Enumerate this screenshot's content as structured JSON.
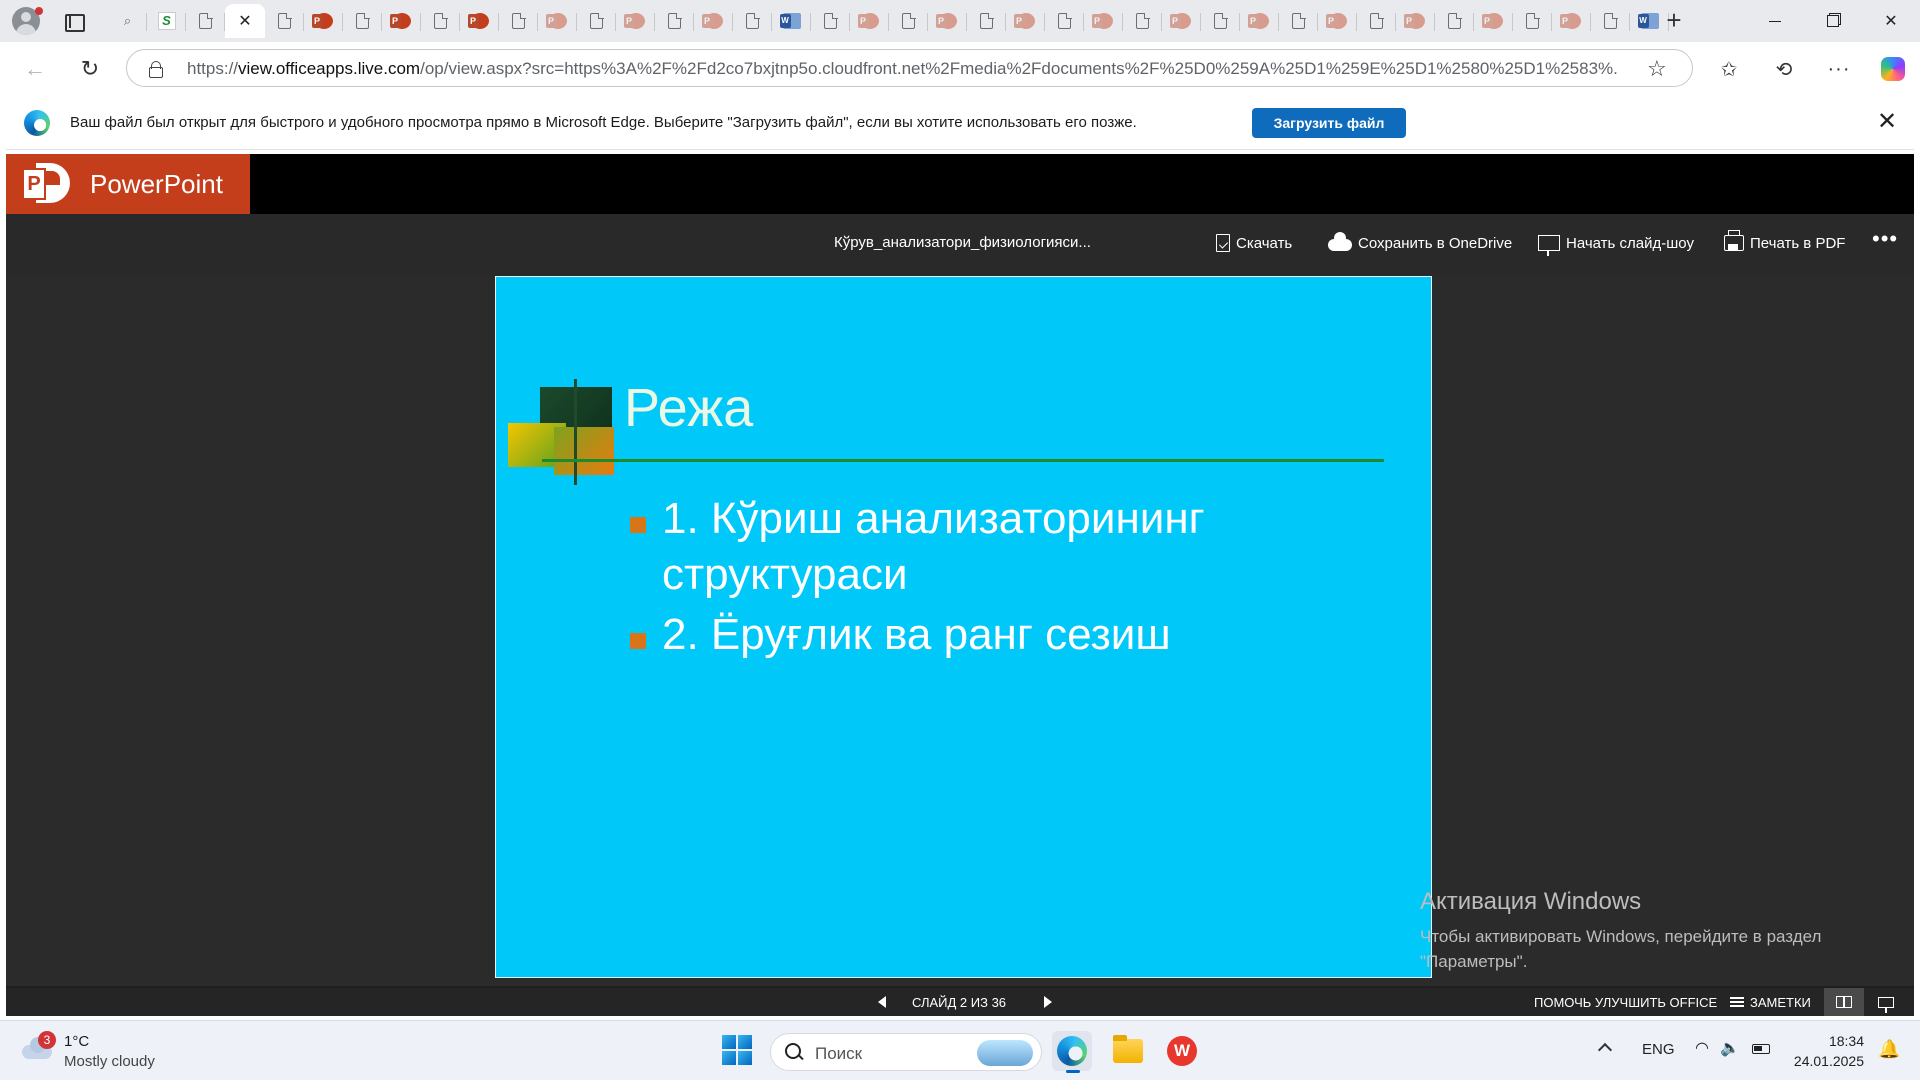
{
  "browser": {
    "tabs": [
      {
        "icon": "search-icon",
        "active": false
      },
      {
        "icon": "green-s-icon",
        "active": false
      },
      {
        "icon": "doc-icon",
        "active": false
      },
      {
        "icon": "close-icon",
        "active": true
      },
      {
        "icon": "doc-icon",
        "active": false
      },
      {
        "icon": "powerpoint-icon",
        "active": false
      },
      {
        "icon": "doc-icon",
        "active": false
      },
      {
        "icon": "powerpoint-icon",
        "active": false
      },
      {
        "icon": "doc-icon",
        "active": false
      },
      {
        "icon": "powerpoint-icon",
        "active": false
      },
      {
        "icon": "doc-icon",
        "active": false
      },
      {
        "icon": "powerpoint-faded-icon",
        "active": false
      },
      {
        "icon": "doc-icon",
        "active": false
      },
      {
        "icon": "powerpoint-faded-icon",
        "active": false
      },
      {
        "icon": "doc-icon",
        "active": false
      },
      {
        "icon": "powerpoint-faded-icon",
        "active": false
      },
      {
        "icon": "doc-icon",
        "active": false
      },
      {
        "icon": "word-icon",
        "active": false
      },
      {
        "icon": "doc-icon",
        "active": false
      },
      {
        "icon": "powerpoint-faded-icon",
        "active": false
      },
      {
        "icon": "doc-icon",
        "active": false
      },
      {
        "icon": "powerpoint-faded-icon",
        "active": false
      },
      {
        "icon": "doc-icon",
        "active": false
      },
      {
        "icon": "powerpoint-faded-icon",
        "active": false
      },
      {
        "icon": "doc-icon",
        "active": false
      },
      {
        "icon": "powerpoint-faded-icon",
        "active": false
      },
      {
        "icon": "doc-icon",
        "active": false
      },
      {
        "icon": "powerpoint-faded-icon",
        "active": false
      },
      {
        "icon": "doc-icon",
        "active": false
      },
      {
        "icon": "powerpoint-faded-icon",
        "active": false
      },
      {
        "icon": "doc-icon",
        "active": false
      },
      {
        "icon": "powerpoint-faded-icon",
        "active": false
      },
      {
        "icon": "doc-icon",
        "active": false
      },
      {
        "icon": "powerpoint-faded-icon",
        "active": false
      },
      {
        "icon": "doc-icon",
        "active": false
      },
      {
        "icon": "powerpoint-faded-icon",
        "active": false
      },
      {
        "icon": "doc-icon",
        "active": false
      },
      {
        "icon": "powerpoint-faded-icon",
        "active": false
      },
      {
        "icon": "doc-icon",
        "active": false
      },
      {
        "icon": "word-icon",
        "active": false
      }
    ],
    "url_host": "view.officeapps.live.com",
    "url_prefix": "https://",
    "url_path": "/op/view.aspx?src=https%3A%2F%2Fd2co7bxjtnp5o.cloudfront.net%2Fmedia%2Fdocuments%2F%25D0%259A%25D1%259E%25D1%2580%25D1%2583%..."
  },
  "notification": {
    "message": "Ваш файл был открыт для быстрого и удобного просмотра прямо в Microsoft Edge. Выберите \"Загрузить файл\", если вы хотите использовать его позже.",
    "button_label": "Загрузить файл"
  },
  "office": {
    "app_name": "PowerPoint",
    "logo_letter": "P",
    "doc_title": "Кўрув_анализатори_физиологияси...",
    "toolbar": {
      "download": "Скачать",
      "save_onedrive": "Сохранить в OneDrive",
      "start_slideshow": "Начать слайд-шоу",
      "print_pdf": "Печать в PDF",
      "more": "•••"
    },
    "slide": {
      "title": "Режа",
      "bullets": [
        "1. Кўриш анализаторининг структураси",
        "2. Ёруғлик ва ранг сезиш"
      ]
    },
    "status": {
      "slide_counter": "СЛАЙД 2 ИЗ 36",
      "help_improve": "ПОМОЧЬ УЛУЧШИТЬ OFFICE",
      "notes": "ЗАМЕТКИ"
    }
  },
  "watermark": {
    "title": "Активация Windows",
    "line1": "Чтобы активировать Windows, перейдите в раздел",
    "line2": "\"Параметры\"."
  },
  "taskbar": {
    "weather_badge": "3",
    "weather_temp": "1°C",
    "weather_desc": "Mostly cloudy",
    "search_placeholder": "Поиск",
    "wps_letter": "W",
    "language": "ENG",
    "time": "18:34",
    "date": "24.01.2025"
  },
  "colors": {
    "slide_background": "#00c8f8",
    "powerpoint_brand": "#c43e1c",
    "notification_button": "#0f6cbd"
  }
}
